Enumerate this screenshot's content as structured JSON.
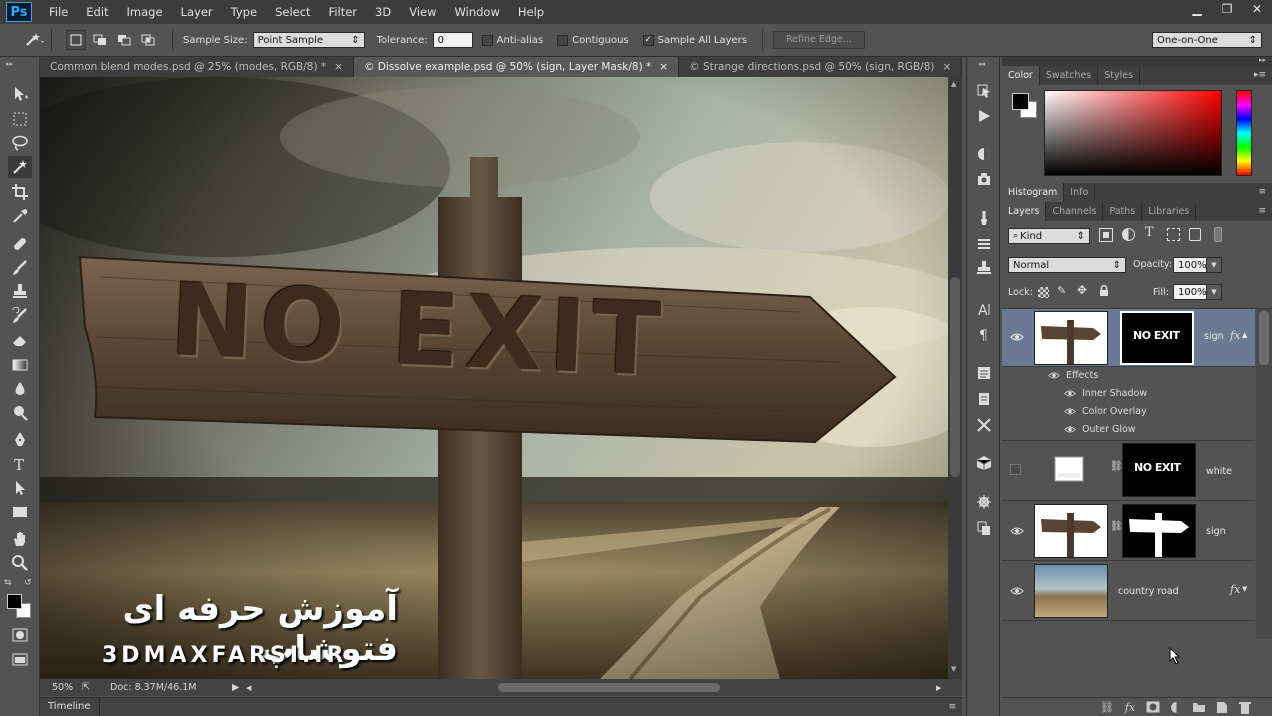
{
  "app": {
    "logo": "Ps"
  },
  "menu": [
    "File",
    "Edit",
    "Image",
    "Layer",
    "Type",
    "Select",
    "Filter",
    "3D",
    "View",
    "Window",
    "Help"
  ],
  "window_controls": {
    "minimize": "▁",
    "restore": "❐",
    "close": "✕"
  },
  "options": {
    "sample_size_label": "Sample Size:",
    "sample_size_value": "Point Sample",
    "tolerance_label": "Tolerance:",
    "tolerance_value": "0",
    "anti_alias": "Anti-alias",
    "contiguous": "Contiguous",
    "sample_all_layers": "Sample All Layers",
    "sample_all_checked": true,
    "refine_edge": "Refine Edge...",
    "workspace": "One-on-One"
  },
  "tabs": [
    {
      "label": "Common blend modes.psd @ 25% (modes, RGB/8) *",
      "close": "×",
      "active": false
    },
    {
      "label": "© Dissolve example.psd @ 50% (sign, Layer Mask/8) *",
      "close": "×",
      "active": true
    },
    {
      "label": "© Strange directions.psd @ 50% (sign, RGB/8)",
      "close": "×",
      "active": false
    }
  ],
  "canvas": {
    "sign_text": "NO EXIT",
    "watermark_fa": "آموزش حرفه ای فتوشاپ",
    "watermark_site": "3DMAXFARSI.IR"
  },
  "status": {
    "zoom": "50%",
    "doc": "Doc: 8.37M/46.1M"
  },
  "timeline_label": "Timeline",
  "color_panel": {
    "tabs": [
      "Color",
      "Swatches",
      "Styles"
    ],
    "fg": "#000000",
    "bg": "#ffffff"
  },
  "histogram_panel": {
    "tabs": [
      "Histogram",
      "Info"
    ]
  },
  "layers_panel": {
    "tabs": [
      "Layers",
      "Channels",
      "Paths",
      "Libraries"
    ],
    "filter_kind": "Kind",
    "blend_mode": "Normal",
    "opacity_label": "Opacity:",
    "opacity_value": "100%",
    "lock_label": "Lock:",
    "fill_label": "Fill:",
    "fill_value": "100%",
    "layers": [
      {
        "name": "sign",
        "mask_text": "NO EXIT",
        "visible": true,
        "fx": "fx",
        "selected": true
      },
      {
        "name": "white",
        "mask_text": "NO EXIT",
        "visible": false
      },
      {
        "name": "sign",
        "visible": true
      },
      {
        "name": "country road",
        "visible": true,
        "fx": "fx"
      }
    ],
    "effects_label": "Effects",
    "effects": [
      "Inner Shadow",
      "Color Overlay",
      "Outer Glow"
    ]
  }
}
